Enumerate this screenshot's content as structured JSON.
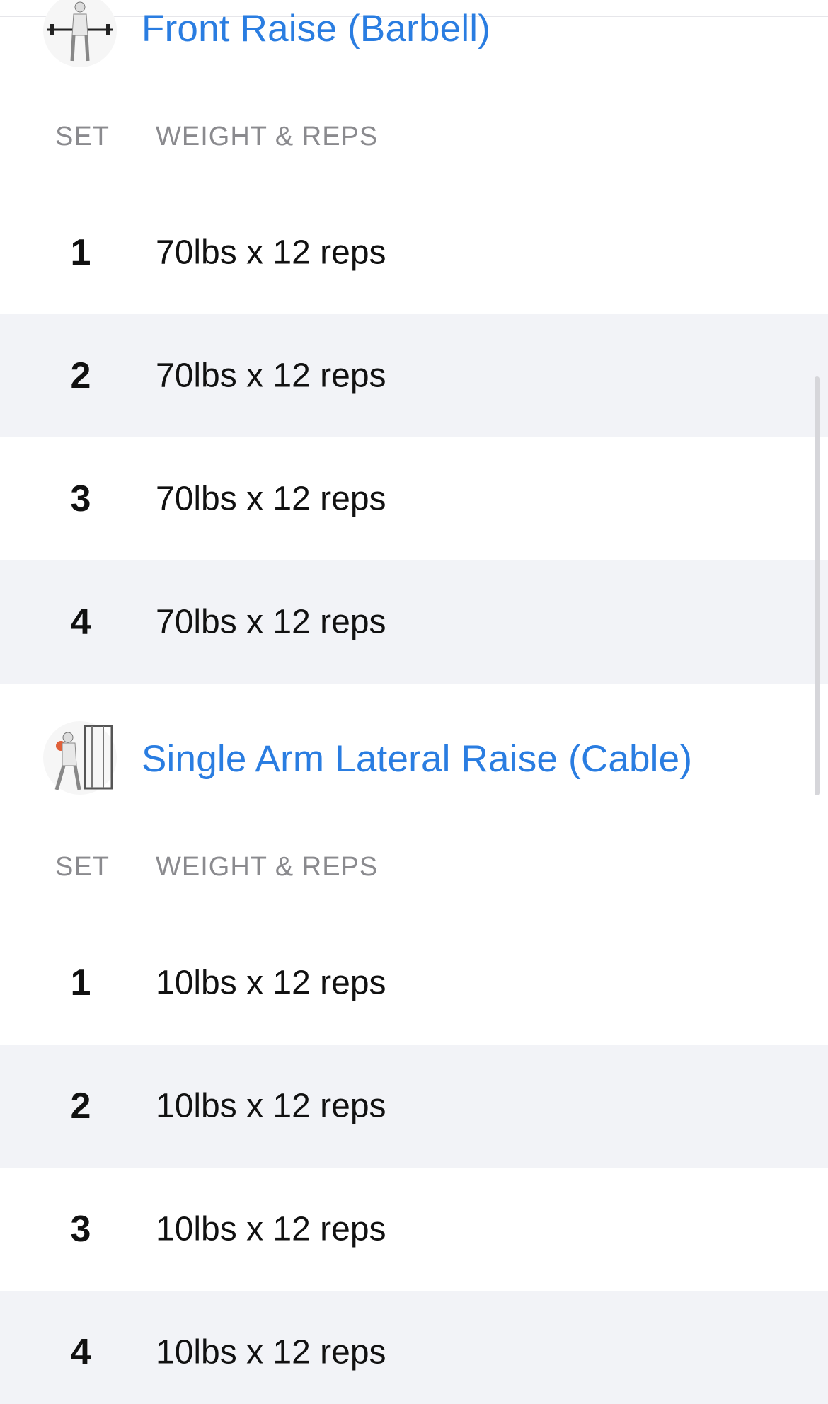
{
  "exercises": [
    {
      "title": "Front Raise (Barbell)",
      "icon": "barbell-front-raise-figure",
      "columns": {
        "set": "SET",
        "weight_reps": "WEIGHT & REPS"
      },
      "sets": [
        {
          "set": "1",
          "value": "70lbs x 12 reps"
        },
        {
          "set": "2",
          "value": "70lbs x 12 reps"
        },
        {
          "set": "3",
          "value": "70lbs x 12 reps"
        },
        {
          "set": "4",
          "value": "70lbs x 12 reps"
        }
      ]
    },
    {
      "title": "Single Arm Lateral Raise (Cable)",
      "icon": "cable-lateral-raise-figure",
      "columns": {
        "set": "SET",
        "weight_reps": "WEIGHT & REPS"
      },
      "sets": [
        {
          "set": "1",
          "value": "10lbs x 12 reps"
        },
        {
          "set": "2",
          "value": "10lbs x 12 reps"
        },
        {
          "set": "3",
          "value": "10lbs x 12 reps"
        },
        {
          "set": "4",
          "value": "10lbs x 12 reps"
        }
      ]
    }
  ],
  "colors": {
    "accent": "#2a7de1",
    "row_alt": "#f2f3f7",
    "header_text": "#8a8a8e"
  }
}
